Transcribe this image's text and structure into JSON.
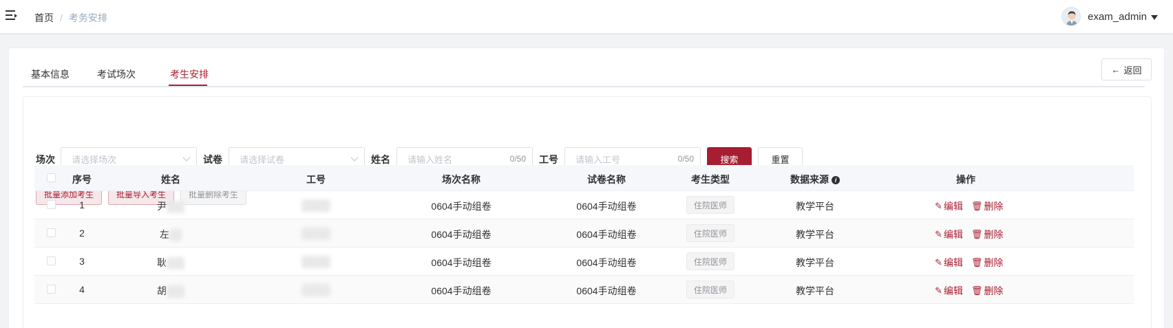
{
  "header": {
    "breadcrumb": {
      "home": "首页",
      "separator": "/",
      "current": "考务安排"
    },
    "user": {
      "name": "exam_admin"
    }
  },
  "tabs": [
    {
      "label": "基本信息",
      "active": false
    },
    {
      "label": "考试场次",
      "active": false
    },
    {
      "label": "考生安排",
      "active": true
    }
  ],
  "back_button": {
    "label": "返回",
    "icon": "arrow-left-icon"
  },
  "filters": {
    "session": {
      "label": "场次",
      "placeholder": "请选择场次"
    },
    "paper": {
      "label": "试卷",
      "placeholder": "请选择试卷"
    },
    "name": {
      "label": "姓名",
      "placeholder": "请输入姓名",
      "count": "0/50"
    },
    "staff_id": {
      "label": "工号",
      "placeholder": "请输入工号",
      "count": "0/50"
    },
    "search_label": "搜索",
    "reset_label": "重置"
  },
  "actions": {
    "batch_add": "批量添加考生",
    "batch_import": "批量导入考生",
    "batch_delete": "批量删除考生"
  },
  "table": {
    "columns": [
      "序号",
      "姓名",
      "工号",
      "场次名称",
      "试卷名称",
      "考生类型",
      "数据来源",
      "操作"
    ],
    "rows": [
      {
        "index": "1",
        "name": "尹",
        "session": "0604手动组卷",
        "paper": "0604手动组卷",
        "type": "住院医师",
        "source": "教学平台"
      },
      {
        "index": "2",
        "name": "左",
        "session": "0604手动组卷",
        "paper": "0604手动组卷",
        "type": "住院医师",
        "source": "教学平台"
      },
      {
        "index": "3",
        "name": "耿",
        "session": "0604手动组卷",
        "paper": "0604手动组卷",
        "type": "住院医师",
        "source": "教学平台"
      },
      {
        "index": "4",
        "name": "胡",
        "session": "0604手动组卷",
        "paper": "0604手动组卷",
        "type": "住院医师",
        "source": "教学平台"
      }
    ],
    "edit_label": "编辑",
    "delete_label": "删除"
  },
  "colors": {
    "accent": "#a71d31",
    "accent_light": "#f6e8ea",
    "border": "#dcdfe6"
  }
}
